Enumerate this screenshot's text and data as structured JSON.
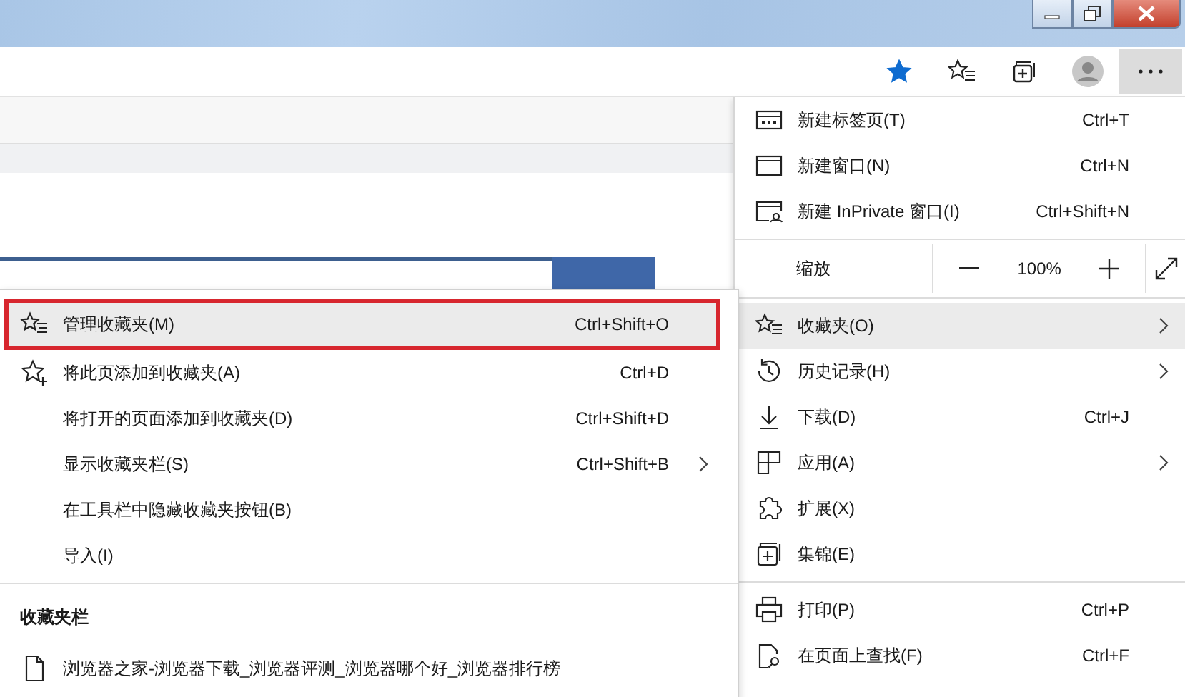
{
  "toolbar": {
    "favorite_on": true
  },
  "main_menu": {
    "sections": [
      {
        "kind": "items",
        "items": [
          {
            "label": "新建标签页(T)",
            "shortcut": "Ctrl+T",
            "submenu": false,
            "selected": false
          },
          {
            "label": "新建窗口(N)",
            "shortcut": "Ctrl+N",
            "submenu": false,
            "selected": false
          },
          {
            "label": "新建 InPrivate 窗口(I)",
            "shortcut": "Ctrl+Shift+N",
            "submenu": false,
            "selected": false
          }
        ]
      },
      {
        "kind": "zoom",
        "label": "缩放",
        "value": "100%"
      },
      {
        "kind": "items",
        "items": [
          {
            "label": "收藏夹(O)",
            "submenu": true,
            "selected": true
          },
          {
            "label": "历史记录(H)",
            "submenu": true,
            "selected": false
          },
          {
            "label": "下载(D)",
            "shortcut": "Ctrl+J",
            "submenu": false,
            "selected": false
          },
          {
            "label": "应用(A)",
            "submenu": true,
            "selected": false
          },
          {
            "label": "扩展(X)",
            "submenu": false,
            "selected": false
          },
          {
            "label": "集锦(E)",
            "submenu": false,
            "selected": false
          }
        ]
      },
      {
        "kind": "items",
        "items": [
          {
            "label": "打印(P)",
            "shortcut": "Ctrl+P",
            "submenu": false,
            "selected": false
          },
          {
            "label": "在页面上查找(F)",
            "shortcut": "Ctrl+F",
            "submenu": false,
            "selected": false
          }
        ]
      }
    ]
  },
  "favorites_menu": {
    "items": [
      {
        "label": "管理收藏夹(M)",
        "shortcut": "Ctrl+Shift+O",
        "submenu": false,
        "selected": true,
        "outlined": true
      },
      {
        "label": "将此页添加到收藏夹(A)",
        "shortcut": "Ctrl+D",
        "submenu": false,
        "selected": false,
        "outlined": false
      },
      {
        "label": "将打开的页面添加到收藏夹(D)",
        "shortcut": "Ctrl+Shift+D",
        "submenu": false,
        "selected": false,
        "outlined": false
      },
      {
        "label": "显示收藏夹栏(S)",
        "shortcut": "Ctrl+Shift+B",
        "submenu": true,
        "selected": false,
        "outlined": false
      },
      {
        "label": "在工具栏中隐藏收藏夹按钮(B)",
        "submenu": false,
        "selected": false,
        "outlined": false
      },
      {
        "label": "导入(I)",
        "submenu": false,
        "selected": false,
        "outlined": false
      }
    ],
    "bar_heading": "收藏夹栏",
    "bar_items": [
      {
        "label": "浏览器之家-浏览器下载_浏览器评测_浏览器哪个好_浏览器排行榜"
      }
    ]
  }
}
